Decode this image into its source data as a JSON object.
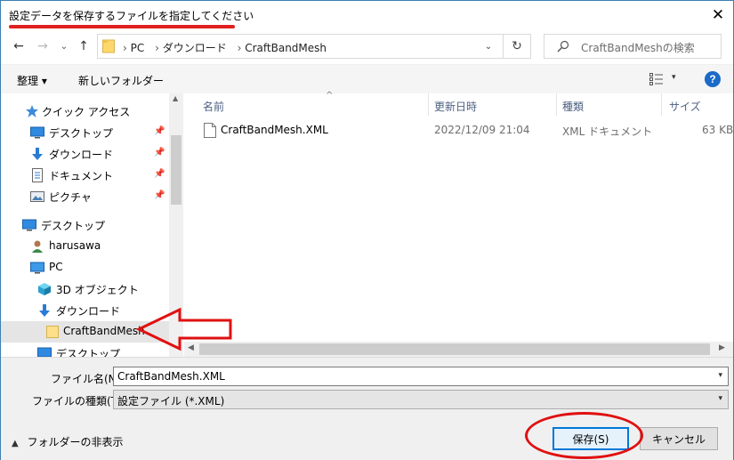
{
  "window": {
    "title": "設定データを保存するファイルを指定してください",
    "close": "✕"
  },
  "nav": {
    "back": "←",
    "forward": "→",
    "history": "⌄",
    "up": "↑"
  },
  "address": {
    "crumbs": [
      "PC",
      "ダウンロード",
      "CraftBandMesh"
    ],
    "separator": "›",
    "dropdown": "⌄",
    "refresh": "↻"
  },
  "search": {
    "placeholder": "CraftBandMeshの検索"
  },
  "toolbar": {
    "organize": "整理 ▾",
    "new_folder": "新しいフォルダー",
    "view_dropdown": "▾",
    "help": "?"
  },
  "sidebar": {
    "items": [
      {
        "label": "クイック アクセス",
        "icon": "star-icon"
      },
      {
        "label": "デスクトップ",
        "icon": "desktop-icon",
        "pinned": true
      },
      {
        "label": "ダウンロード",
        "icon": "download-icon",
        "pinned": true
      },
      {
        "label": "ドキュメント",
        "icon": "document-icon",
        "pinned": true
      },
      {
        "label": "ピクチャ",
        "icon": "picture-icon",
        "pinned": true
      },
      {
        "label": "デスクトップ",
        "icon": "desktop-icon"
      },
      {
        "label": "harusawa",
        "icon": "user-icon"
      },
      {
        "label": "PC",
        "icon": "pc-icon"
      },
      {
        "label": "3D オブジェクト",
        "icon": "cube-icon"
      },
      {
        "label": "ダウンロード",
        "icon": "download-icon"
      },
      {
        "label": "CraftBandMesh",
        "icon": "folder-icon",
        "selected": true
      },
      {
        "label": "デスクトップ",
        "icon": "desktop-icon"
      }
    ],
    "pin_glyph": "📌"
  },
  "file_list": {
    "columns": [
      "名前",
      "更新日時",
      "種類",
      "サイズ"
    ],
    "rows": [
      {
        "name": "CraftBandMesh.XML",
        "modified": "2022/12/09 21:04",
        "type": "XML ドキュメント",
        "size": "63 KB"
      }
    ]
  },
  "form": {
    "filename_label": "ファイル名(N):",
    "filename_value": "CraftBandMesh.XML",
    "filetype_label": "ファイルの種類(T):",
    "filetype_value": "設定ファイル (*.XML)",
    "hide_folders": "フォルダーの非表示",
    "save": "保存(S)",
    "cancel": "キャンセル"
  },
  "colors": {
    "annotation": "#e01010",
    "selection": "#cce8ff",
    "accent": "#0078d7"
  }
}
